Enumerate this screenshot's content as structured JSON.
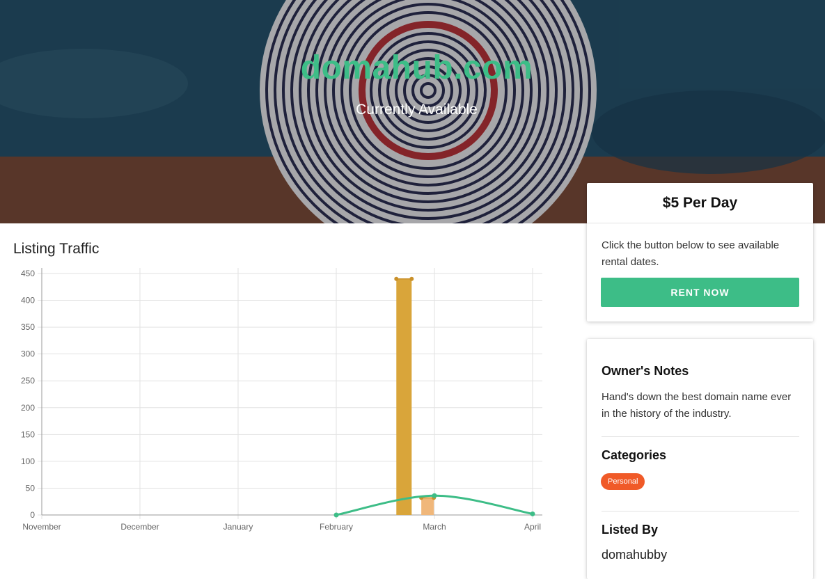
{
  "hero": {
    "title": "domahub.com",
    "subtitle": "Currently Available"
  },
  "traffic": {
    "title": "Listing Traffic"
  },
  "chart_data": {
    "type": "line",
    "title": "Listing Traffic",
    "x_ticks": [
      "November",
      "December",
      "January",
      "February",
      "March",
      "April"
    ],
    "y_ticks": [
      0,
      50,
      100,
      150,
      200,
      250,
      300,
      350,
      400,
      450
    ],
    "ylim": [
      0,
      450
    ],
    "grid": true,
    "series": [
      {
        "kind": "line",
        "color": "#3dbd87",
        "points": [
          {
            "x": "February",
            "y": 0
          },
          {
            "x": "March",
            "y": 36
          },
          {
            "x": "April",
            "y": 2
          }
        ]
      },
      {
        "kind": "bar",
        "color": "#d9a53a",
        "points": [
          {
            "x": "late February",
            "y": 440
          }
        ]
      },
      {
        "kind": "bar",
        "color": "#f0b77a",
        "points": [
          {
            "x": "early March",
            "y": 32
          }
        ]
      }
    ]
  },
  "pricing": {
    "price": "$5 Per Day",
    "description": "Click the button below to see available rental dates.",
    "button_label": "RENT NOW"
  },
  "info": {
    "notes_heading": "Owner's Notes",
    "notes_text": "Hand's down the best domain name ever in the history of the industry.",
    "categories_heading": "Categories",
    "category": "Personal",
    "listed_by_heading": "Listed By",
    "listed_by": "domahubby"
  },
  "colors": {
    "accent": "#3dbd87",
    "badge": "#f05a28"
  }
}
